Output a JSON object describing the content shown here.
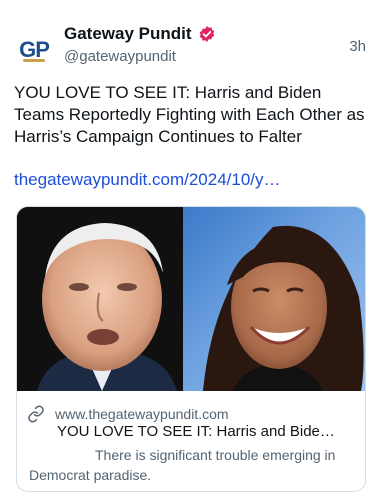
{
  "post": {
    "author_name": "Gateway Pundit",
    "author_handle": "@gatewaypundit",
    "avatar_initials": "GP",
    "time_ago": "3h",
    "verified_icon": "verified-badge-icon",
    "headline": "YOU LOVE TO SEE IT: Harris and Biden Teams Reportedly Fighting with Each Other as Harris’s Campaign Continues to Falter",
    "link_text": "thegatewaypundit.com/2024/10/y…"
  },
  "card": {
    "domain": "www.thegatewaypundit.com",
    "title": "YOU LOVE TO SEE IT: Harris and Bide…",
    "description": "There is significant trouble emerging in Democrat paradise.",
    "link_icon": "link-icon"
  },
  "colors": {
    "verified_badge": "#e0245e",
    "link": "#1d4ed8",
    "secondary_text": "#536471",
    "avatar_blue": "#1f4e8c",
    "avatar_gold": "#c9a14a"
  }
}
